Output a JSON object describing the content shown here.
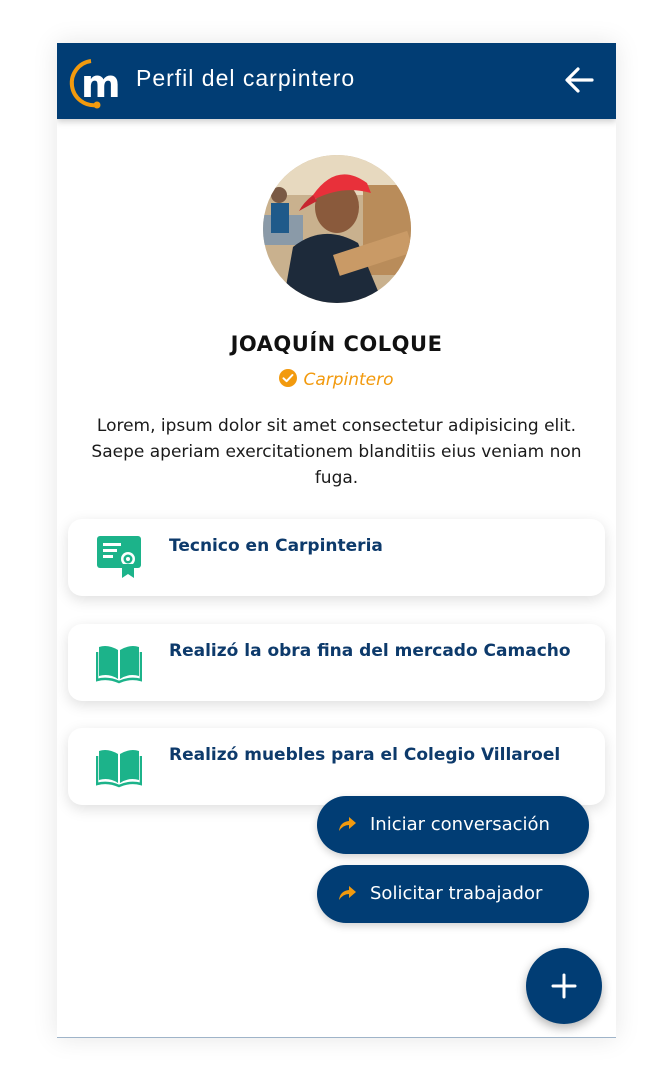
{
  "header": {
    "title": "Perfil del carpintero"
  },
  "profile": {
    "name": "JOAQUÍN COLQUE",
    "role": "Carpintero",
    "bio": "Lorem, ipsum dolor sit amet consectetur adipisicing elit. Saepe aperiam exercitationem blanditiis eius veniam non fuga."
  },
  "cards": [
    {
      "icon": "certificate-icon",
      "text": "Tecnico en Carpinteria"
    },
    {
      "icon": "book-icon",
      "text": "Realizó la obra fina del mercado Camacho"
    },
    {
      "icon": "book-icon",
      "text": "Realizó muebles para el Colegio Villaroel"
    }
  ],
  "actions": [
    {
      "icon": "share-arrow-icon",
      "label": "Iniciar conversación"
    },
    {
      "icon": "share-arrow-icon",
      "label": "Solicitar trabajador"
    }
  ],
  "fab": {
    "icon": "plus-icon"
  },
  "colors": {
    "primary": "#013d74",
    "accent": "#f29a0e",
    "icon_green": "#1cb38a",
    "card_text": "#0d3a6b"
  }
}
